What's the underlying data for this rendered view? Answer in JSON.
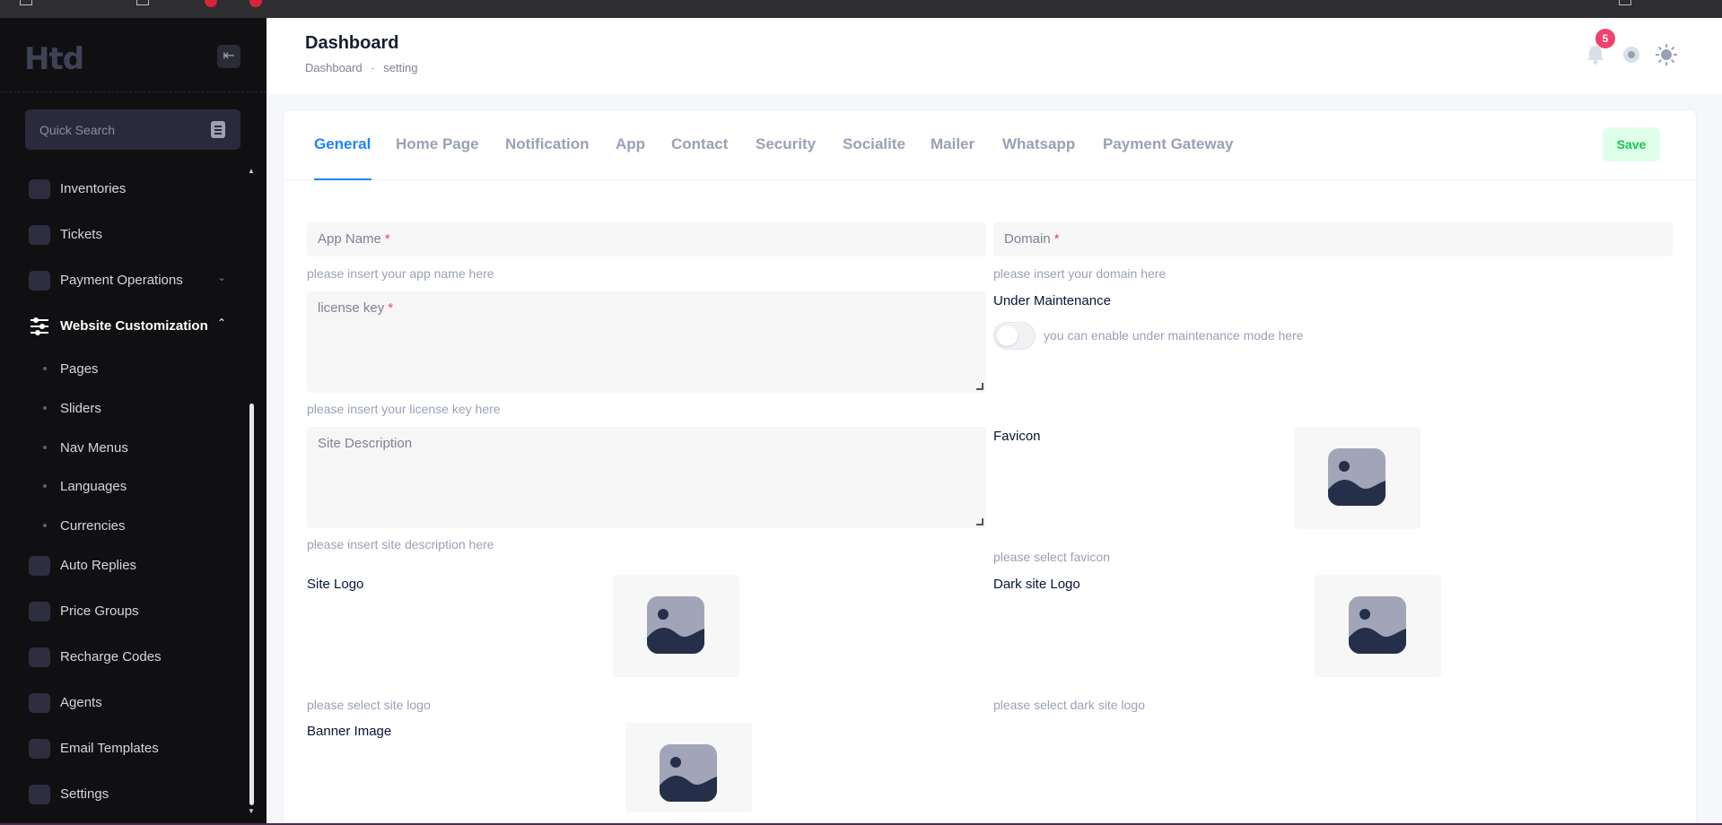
{
  "sidebar": {
    "logo_text": "Htd",
    "search_placeholder": "Quick Search",
    "items": [
      {
        "label": "Inventories",
        "icon": "box-icon"
      },
      {
        "label": "Tickets",
        "icon": "chat-icon"
      },
      {
        "label": "Payment Operations",
        "icon": "money-icon",
        "chevron": "down"
      },
      {
        "label": "Website Customization",
        "icon": "sliders-icon",
        "chevron": "up",
        "active": true
      },
      {
        "label": "Auto Replies",
        "icon": "inbox-icon"
      },
      {
        "label": "Price Groups",
        "icon": "tag-icon"
      },
      {
        "label": "Recharge Codes",
        "icon": "wallet-icon"
      },
      {
        "label": "Agents",
        "icon": "id-card-icon"
      },
      {
        "label": "Email Templates",
        "icon": "layout-icon"
      },
      {
        "label": "Settings",
        "icon": "gear-icon"
      }
    ],
    "sub_items": [
      "Pages",
      "Sliders",
      "Nav Menus",
      "Languages",
      "Currencies"
    ]
  },
  "header": {
    "title": "Dashboard",
    "breadcrumb": [
      "Dashboard",
      "setting"
    ],
    "notification_count": "5"
  },
  "tabs": [
    "General",
    "Home Page",
    "Notification",
    "App",
    "Contact",
    "Security",
    "Socialite",
    "Mailer",
    "Whatsapp",
    "Payment Gateway"
  ],
  "save_label": "Save",
  "form": {
    "app_name": {
      "placeholder": "App Name",
      "required": "*",
      "hint": "please insert your app name here"
    },
    "domain": {
      "placeholder": "Domain",
      "required": "*",
      "hint": "please insert your domain here"
    },
    "license_key": {
      "placeholder": "license key",
      "required": "*",
      "hint": "please insert your license key here"
    },
    "maintenance": {
      "label": "Under Maintenance",
      "hint": "you can enable under maintenance mode here",
      "enabled": false
    },
    "site_description": {
      "placeholder": "Site Description",
      "hint": "please insert site description here"
    },
    "favicon": {
      "label": "Favicon",
      "hint": "please select favicon"
    },
    "site_logo": {
      "label": "Site Logo",
      "hint": "please select site logo"
    },
    "dark_logo": {
      "label": "Dark site Logo",
      "hint": "please select dark site logo"
    },
    "banner": {
      "label": "Banner Image"
    }
  },
  "colors": {
    "accent": "#1b84ff",
    "sidebar_bg": "#101013",
    "success": "#17c653",
    "danger": "#f1416c"
  }
}
